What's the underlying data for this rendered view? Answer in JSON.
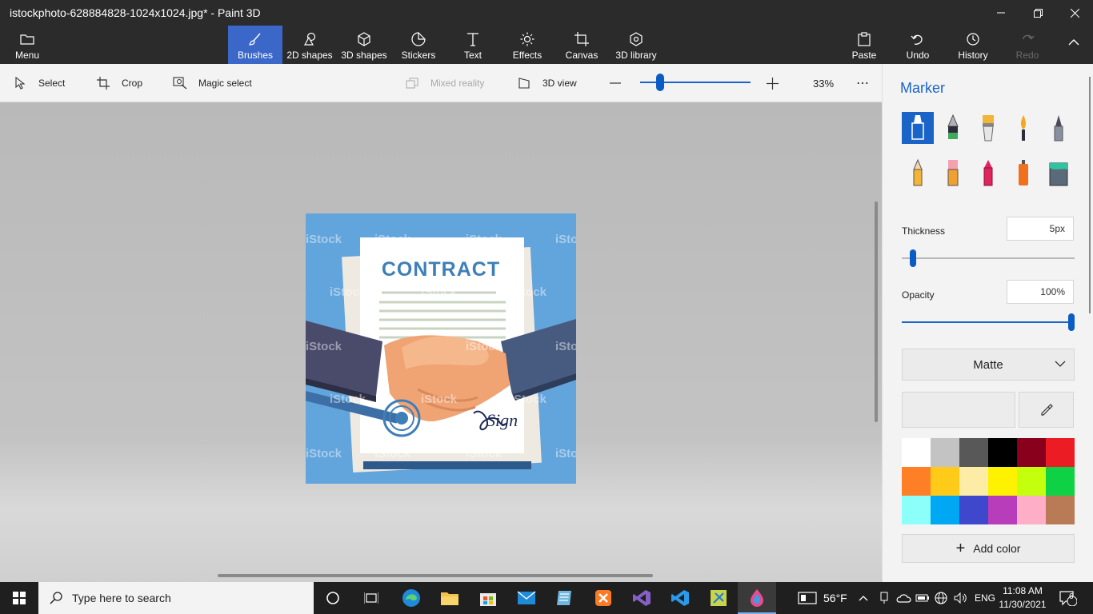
{
  "window": {
    "title": "istockphoto-628884828-1024x1024.jpg* - Paint 3D",
    "controls": [
      "minimize",
      "restore",
      "close"
    ]
  },
  "toolbar": {
    "menu_label": "Menu",
    "items": [
      {
        "label": "Brushes",
        "icon": "brush-icon",
        "active": true
      },
      {
        "label": "2D shapes",
        "icon": "2d-shapes-icon"
      },
      {
        "label": "3D shapes",
        "icon": "3d-shapes-icon"
      },
      {
        "label": "Stickers",
        "icon": "stickers-icon"
      },
      {
        "label": "Text",
        "icon": "text-icon"
      },
      {
        "label": "Effects",
        "icon": "effects-icon"
      },
      {
        "label": "Canvas",
        "icon": "canvas-icon"
      },
      {
        "label": "3D library",
        "icon": "3d-library-icon"
      }
    ],
    "right_items": [
      {
        "label": "Paste",
        "icon": "paste-icon"
      },
      {
        "label": "Undo",
        "icon": "undo-icon"
      },
      {
        "label": "History",
        "icon": "history-icon"
      },
      {
        "label": "Redo",
        "icon": "redo-icon",
        "disabled": true
      }
    ]
  },
  "subbar": {
    "select": "Select",
    "crop": "Crop",
    "magic_select": "Magic select",
    "mixed_reality": "Mixed reality",
    "view_3d": "3D view",
    "zoom_value": 0.15,
    "zoom_label": "33%"
  },
  "artwork": {
    "heading": "CONTRACT",
    "watermark": "iStock",
    "signature": "Sign"
  },
  "panel": {
    "title": "Marker",
    "brushes": [
      "marker-icon",
      "calligraphy-pen-icon",
      "oil-brush-icon",
      "watercolor-icon",
      "pixel-pen-icon",
      "pencil-icon",
      "eraser-icon",
      "crayon-icon",
      "spray-can-icon",
      "fill-bucket-icon"
    ],
    "thickness_label": "Thickness",
    "thickness_value": "5px",
    "thickness_level": 0.05,
    "opacity_label": "Opacity",
    "opacity_value": "100%",
    "opacity_level": 1.0,
    "finish": "Matte",
    "palette": [
      "#ffffff",
      "#c3c3c3",
      "#585858",
      "#000000",
      "#88001b",
      "#ec1c24",
      "#ff7f27",
      "#ffca18",
      "#fdeca6",
      "#fff200",
      "#c4ff0e",
      "#0ed145",
      "#8cfffb",
      "#00a8f3",
      "#3f48cc",
      "#b83dba",
      "#ffaec8",
      "#b97a56"
    ],
    "add_color": "Add color"
  },
  "taskbar": {
    "search_placeholder": "Type here to search",
    "weather": "56°F",
    "language": "ENG",
    "time": "11:08 AM",
    "date": "11/30/2021",
    "notifications": "6"
  }
}
